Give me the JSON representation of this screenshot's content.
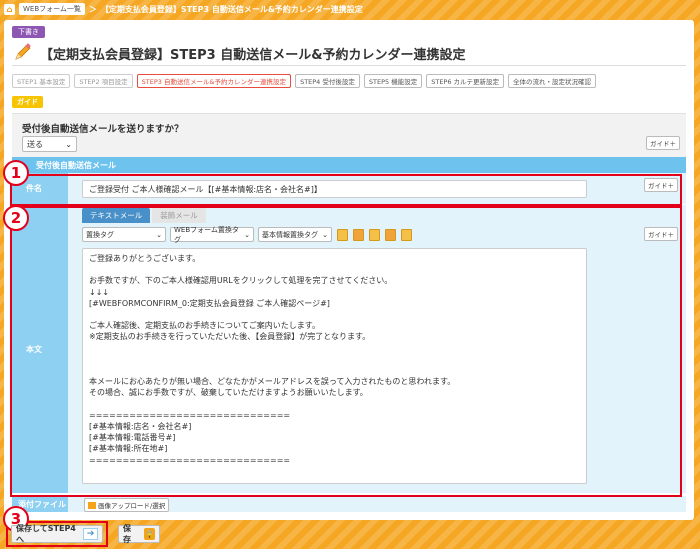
{
  "topbar": {
    "home_label": "WEBフォーム一覧",
    "separator": "＞",
    "current": "【定期支払会員登録】STEP3 自動送信メール&予約カレンダー連携設定"
  },
  "header": {
    "draft_badge": "下書き",
    "title": "【定期支払会員登録】STEP3 自動送信メール&予約カレンダー連携設定"
  },
  "steps": [
    {
      "label": "STEP1 基本設定",
      "state": "done"
    },
    {
      "label": "STEP2 項目設定",
      "state": "done"
    },
    {
      "label": "STEP3 自動送信メール&予約カレンダー連携設定",
      "state": "active"
    },
    {
      "label": "STEP4 受付後設定",
      "state": "upcoming"
    },
    {
      "label": "STEP5 機能設定",
      "state": "upcoming"
    },
    {
      "label": "STEP6 カルテ更新設定",
      "state": "upcoming"
    },
    {
      "label": "全体の流れ・設定状況確認",
      "state": "upcoming"
    }
  ],
  "guide_tag": "ガイド",
  "question": {
    "label": "受付後自動送信メールを送りますか？",
    "selected": "送る",
    "guide_button": "ガイド＋"
  },
  "section": {
    "title": "受付後自動送信メール",
    "subject_label": "件名",
    "subject_value": "ご登録受付 ご本人様確認メール【[#基本情報:店名・会社名#]】",
    "subject_guide": "ガイド＋",
    "body_label": "本文",
    "body_guide": "ガイド＋",
    "tab_text": "テキストメール",
    "tab_html": "装飾メール",
    "select_replace": "置換タグ",
    "select_form": "WEBフォーム置換タグ",
    "select_basic": "基本情報置換タグ",
    "body_text": "ご登録ありがとうございます。\n\nお手数ですが、下のご本人様確認用URLをクリックして処理を完了させてください。\n↓↓↓\n[#WEBFORMCONFIRM_0:定期支払会員登録 ご本人確認ページ#]\n\nご本人確認後、定期支払のお手続きについてご案内いたします。\n※定期支払のお手続きを行っていただいた後、【会員登録】が完了となります。\n\n\n\n本メールにお心あたりが無い場合、どなたかがメールアドレスを誤って入力されたものと思われます。\nその場合、誠にお手数ですが、破棄していただけますようお願いいたします。\n\n==============================\n[#基本情報:店名・会社名#]\n[#基本情報:電話番号#]\n[#基本情報:所在地#]\n==============================",
    "attach_label": "添付ファイル",
    "attach_button": "画像アップロード/選択"
  },
  "annotations": {
    "badge1": "1",
    "badge2": "2",
    "badge3": "3"
  },
  "footer": {
    "save_next": "保存してSTEP4へ",
    "save": "保存"
  },
  "colors": {
    "accent_orange": "#f5a623",
    "section_blue": "#6ec3ee",
    "highlight_red": "#e3001b",
    "draft_purple": "#8e56b3"
  }
}
